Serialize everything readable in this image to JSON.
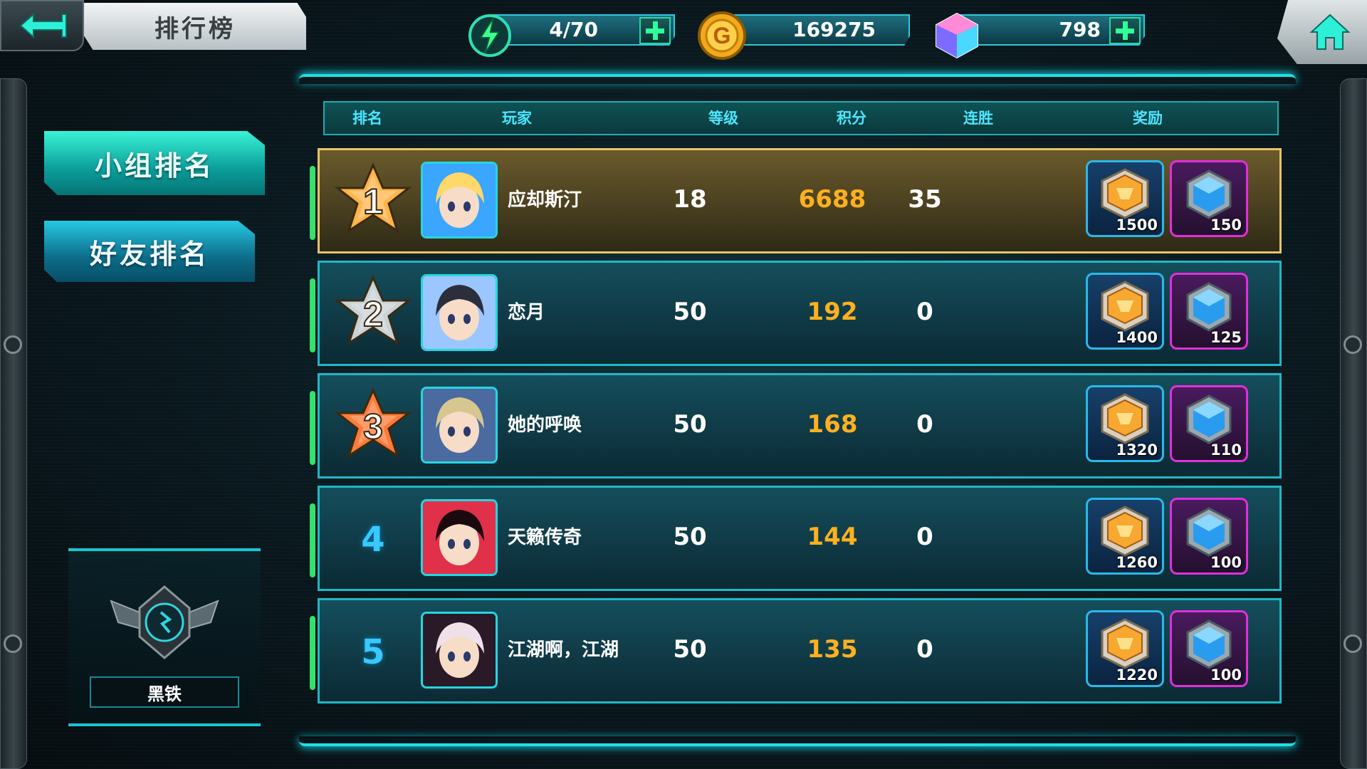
{
  "header": {
    "title": "排行榜",
    "stamina": "4/70",
    "gold": "169275",
    "gems": "798",
    "gold_icon_letter": "G"
  },
  "tabs": [
    {
      "label": "小组排名",
      "active": true
    },
    {
      "label": "好友排名",
      "active": false
    }
  ],
  "rank_tier": {
    "name": "黑铁"
  },
  "table": {
    "columns": [
      "排名",
      "玩家",
      "等级",
      "积分",
      "连胜",
      "奖励"
    ],
    "rows": [
      {
        "rank": "1",
        "name": "应却斯汀",
        "level": "18",
        "score": "6688",
        "streak": "35",
        "reward_gold": "1500",
        "reward_gem": "150",
        "badge_color": "#ffb44a"
      },
      {
        "rank": "2",
        "name": "恋月",
        "level": "50",
        "score": "192",
        "streak": "0",
        "reward_gold": "1400",
        "reward_gem": "125",
        "badge_color": "#c9d2d6"
      },
      {
        "rank": "3",
        "name": "她的呼唤",
        "level": "50",
        "score": "168",
        "streak": "0",
        "reward_gold": "1320",
        "reward_gem": "110",
        "badge_color": "#ff7a3a"
      },
      {
        "rank": "4",
        "name": "天籁传奇",
        "level": "50",
        "score": "144",
        "streak": "0",
        "reward_gold": "1260",
        "reward_gem": "100",
        "badge_color": ""
      },
      {
        "rank": "5",
        "name": "江湖啊，江湖",
        "level": "50",
        "score": "135",
        "streak": "0",
        "reward_gold": "1220",
        "reward_gem": "100",
        "badge_color": ""
      }
    ]
  },
  "icons": {
    "back": "back-arrow-icon",
    "home": "home-icon",
    "stamina": "lightning-icon",
    "gold": "gold-coin-icon",
    "gem": "gem-icon",
    "plus": "plus-icon"
  },
  "colors": {
    "accent": "#1fe0e6",
    "score": "#ffb020",
    "first_row_border": "#e6c468",
    "gold_reward_border": "#2ab9e8",
    "gem_reward_border": "#e22fd9"
  }
}
